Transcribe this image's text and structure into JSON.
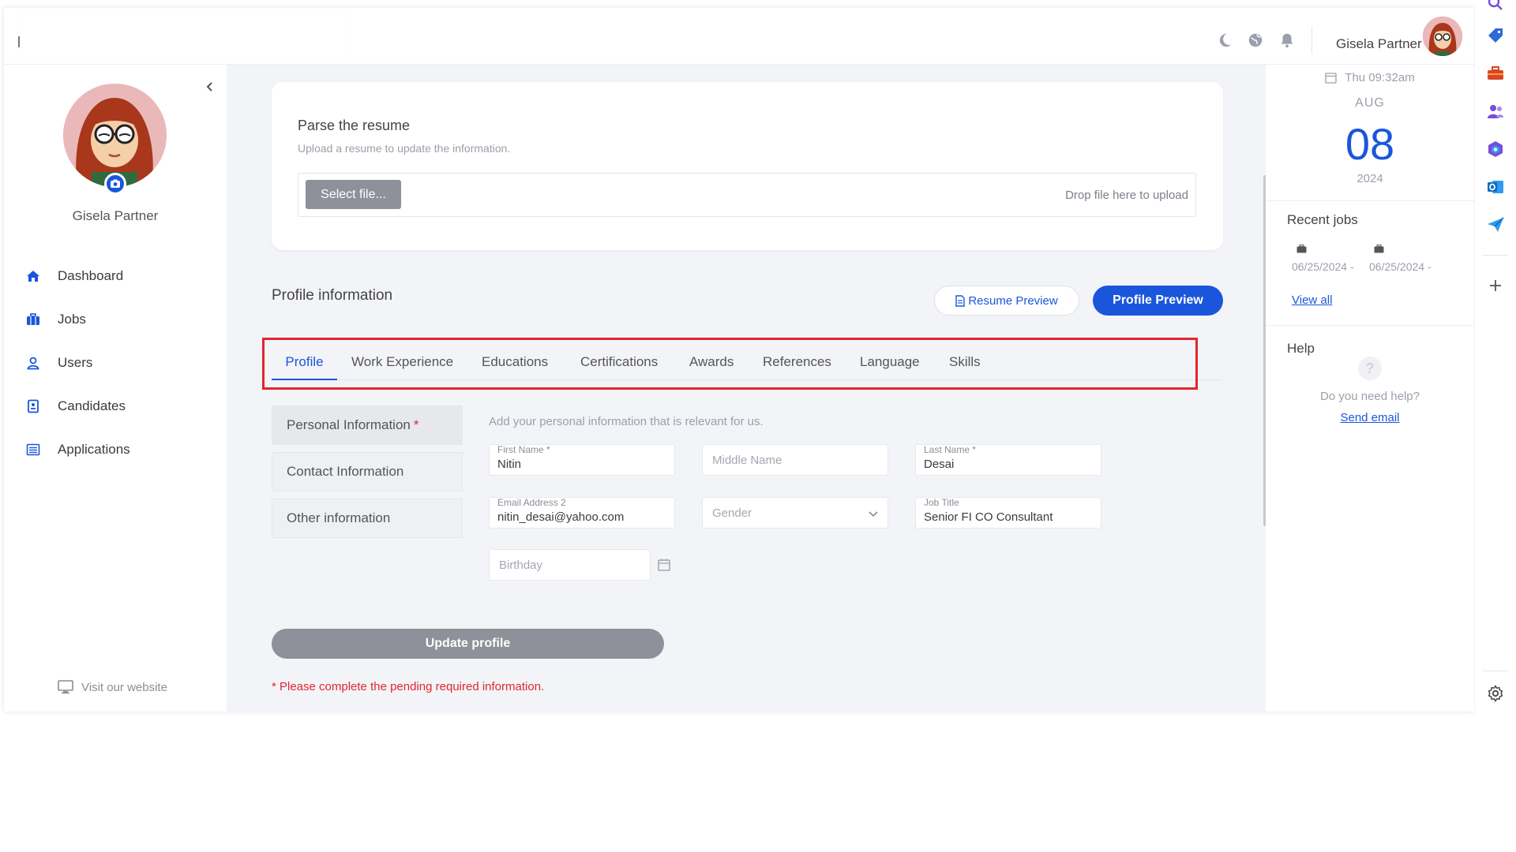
{
  "header": {
    "username": "Gisela Partner",
    "icons": [
      "moon-icon",
      "globe-icon",
      "bell-icon"
    ]
  },
  "sidebar": {
    "name": "Gisela Partner",
    "items": [
      {
        "label": "Dashboard",
        "icon": "home-icon"
      },
      {
        "label": "Jobs",
        "icon": "briefcase-icon"
      },
      {
        "label": "Users",
        "icon": "user-icon"
      },
      {
        "label": "Candidates",
        "icon": "id-card-icon"
      },
      {
        "label": "Applications",
        "icon": "list-icon"
      }
    ],
    "visit": "Visit our website"
  },
  "parse": {
    "title": "Parse the resume",
    "subtitle": "Upload a resume to update the information.",
    "select_label": "Select file...",
    "drop_text": "Drop file here to upload"
  },
  "profile": {
    "title": "Profile information",
    "resume_preview": "Resume Preview",
    "profile_preview": "Profile Preview",
    "tabs": [
      "Profile",
      "Work Experience",
      "Educations",
      "Certifications",
      "Awards",
      "References",
      "Language",
      "Skills"
    ],
    "active_tab": "Profile",
    "subnav": [
      "Personal Information",
      "Contact Information",
      "Other information"
    ],
    "subnav_required_mark": "*",
    "hint": "Add your personal information that is relevant for us.",
    "fields": {
      "first_name_label": "First Name *",
      "first_name_value": "Nitin",
      "middle_name_placeholder": "Middle Name",
      "last_name_label": "Last Name *",
      "last_name_value": "Desai",
      "email_label": "Email Address 2",
      "email_value": "nitin_desai@yahoo.com",
      "gender_placeholder": "Gender",
      "job_title_label": "Job Title",
      "job_title_value": "Senior FI CO Consultant",
      "birthday_placeholder": "Birthday"
    },
    "update_label": "Update profile",
    "pending_note": "* Please complete the pending required information."
  },
  "rightpanel": {
    "datetime": "Thu 09:32am",
    "month": "AUG",
    "day": "08",
    "year": "2024",
    "recent_title": "Recent jobs",
    "jobs": [
      "06/25/2024 -",
      "06/25/2024 -"
    ],
    "view_all": "View all",
    "help_title": "Help",
    "help_q": "?",
    "help_text": "Do you need help?",
    "send_email": "Send email"
  },
  "colors": {
    "accent": "#1a56db",
    "highlight": "#e0262f",
    "disabled": "#8e9199"
  }
}
